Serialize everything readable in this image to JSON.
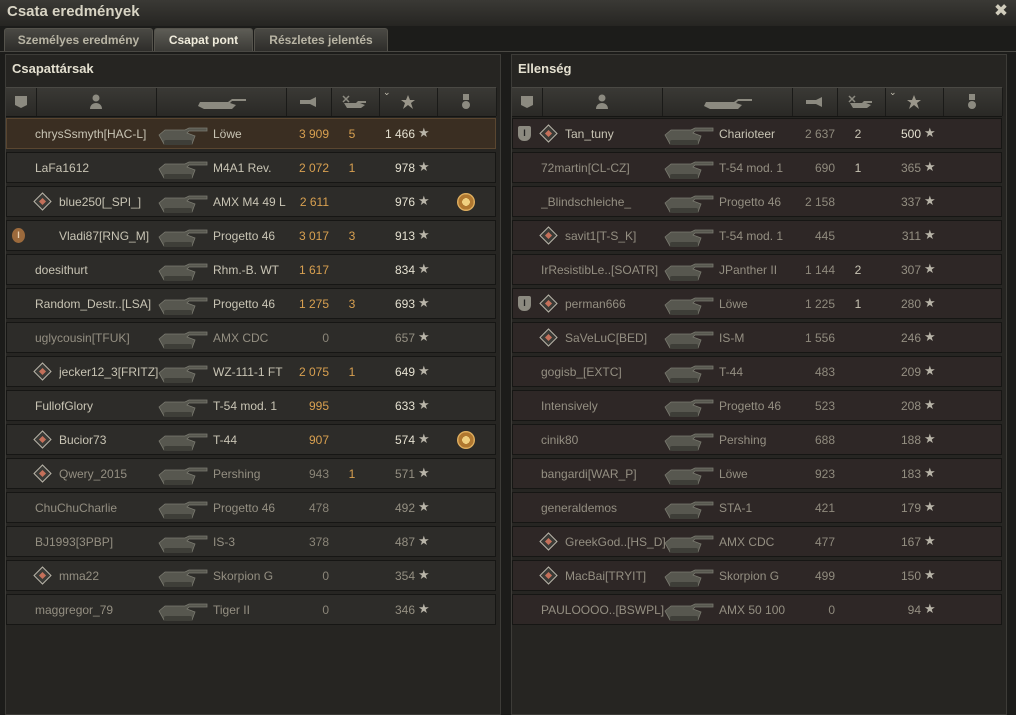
{
  "window": {
    "title": "Csata eredmények",
    "close_glyph": "✖"
  },
  "tabs": [
    {
      "label": "Személyes eredmény",
      "active": false
    },
    {
      "label": "Csapat pont",
      "active": true
    },
    {
      "label": "Részletes jelentés",
      "active": false
    }
  ],
  "columns": {
    "icons": [
      "squad-icon",
      "player-icon",
      "tank-icon",
      "damage-icon",
      "frags-icon",
      "points-star-icon",
      "medal-icon"
    ],
    "sorted_by": "points"
  },
  "colors": {
    "accent_damage": "#d8a050",
    "points": "#e4e0d0",
    "highlight_row": "#3a2e22"
  },
  "teams": [
    {
      "title": "Csapattársak",
      "side": "friendly",
      "rows": [
        {
          "name": "chrysSsmyth[HAC-L]",
          "vehicle": "Löwe",
          "damage": "3 909",
          "frags": "5",
          "points": "1 466",
          "me": true,
          "clan": false,
          "mark": "",
          "medal": false,
          "dead": false
        },
        {
          "name": "LaFa1612",
          "vehicle": "M4A1 Rev.",
          "damage": "2 072",
          "frags": "1",
          "points": "978",
          "clan": false,
          "mark": "",
          "medal": false,
          "dead": false
        },
        {
          "name": "blue250[_SPI_]",
          "vehicle": "AMX M4 49 L",
          "damage": "2 611",
          "frags": "",
          "points": "976",
          "clan": true,
          "mark": "",
          "medal": true,
          "dead": false
        },
        {
          "name": "Vladi87[RNG_M]",
          "vehicle": "Progetto 46",
          "damage": "3 017",
          "frags": "3",
          "points": "913",
          "clan": false,
          "mark": "copper",
          "medal": false,
          "dead": false
        },
        {
          "name": "doesithurt",
          "vehicle": "Rhm.-B. WT",
          "damage": "1 617",
          "frags": "",
          "points": "834",
          "clan": false,
          "mark": "",
          "medal": false,
          "dead": false
        },
        {
          "name": "Random_Destr..[LSA]",
          "vehicle": "Progetto 46",
          "damage": "1 275",
          "frags": "3",
          "points": "693",
          "clan": false,
          "mark": "",
          "medal": false,
          "dead": false
        },
        {
          "name": "uglycousin[TFUK]",
          "vehicle": "AMX CDC",
          "damage": "0",
          "frags": "",
          "points": "657",
          "clan": false,
          "mark": "",
          "medal": false,
          "dead": true
        },
        {
          "name": "jecker12_3[FRITZ]",
          "vehicle": "WZ-111-1 FT",
          "damage": "2 075",
          "frags": "1",
          "points": "649",
          "clan": true,
          "mark": "",
          "medal": false,
          "dead": false
        },
        {
          "name": "FullofGlory",
          "vehicle": "T-54 mod. 1",
          "damage": "995",
          "frags": "",
          "points": "633",
          "clan": false,
          "mark": "",
          "medal": false,
          "dead": false
        },
        {
          "name": "Bucior73",
          "vehicle": "T-44",
          "damage": "907",
          "frags": "",
          "points": "574",
          "clan": true,
          "mark": "",
          "medal": true,
          "dead": false
        },
        {
          "name": "Qwery_2015",
          "vehicle": "Pershing",
          "damage": "943",
          "frags": "1",
          "points": "571",
          "clan": true,
          "mark": "",
          "medal": false,
          "dead": true
        },
        {
          "name": "ChuChuCharlie",
          "vehicle": "Progetto 46",
          "damage": "478",
          "frags": "",
          "points": "492",
          "clan": false,
          "mark": "",
          "medal": false,
          "dead": true
        },
        {
          "name": "BJ1993[3PBP]",
          "vehicle": "IS-3",
          "damage": "378",
          "frags": "",
          "points": "487",
          "clan": false,
          "mark": "",
          "medal": false,
          "dead": true
        },
        {
          "name": "mma22",
          "vehicle": "Skorpion G",
          "damage": "0",
          "frags": "",
          "points": "354",
          "clan": true,
          "mark": "",
          "medal": false,
          "dead": true
        },
        {
          "name": "maggregor_79",
          "vehicle": "Tiger II",
          "damage": "0",
          "frags": "",
          "points": "346",
          "clan": false,
          "mark": "",
          "medal": false,
          "dead": true
        }
      ]
    },
    {
      "title": "Ellenség",
      "side": "enemy",
      "rows": [
        {
          "name": "Tan_tuny",
          "vehicle": "Charioteer",
          "damage": "2 637",
          "frags": "2",
          "points": "500",
          "clan": true,
          "mark": "grey",
          "medal": false,
          "dead": false
        },
        {
          "name": "72martin[CL-CZ]",
          "vehicle": "T-54 mod. 1",
          "damage": "690",
          "frags": "1",
          "points": "365",
          "clan": false,
          "mark": "",
          "medal": false,
          "dead": true
        },
        {
          "name": "_Blindschleiche_",
          "vehicle": "Progetto 46",
          "damage": "2 158",
          "frags": "",
          "points": "337",
          "clan": false,
          "mark": "",
          "medal": false,
          "dead": true
        },
        {
          "name": "savit1[T-S_K]",
          "vehicle": "T-54 mod. 1",
          "damage": "445",
          "frags": "",
          "points": "311",
          "clan": true,
          "mark": "",
          "medal": false,
          "dead": true
        },
        {
          "name": "IrResistibLe..[SOATR]",
          "vehicle": "JPanther II",
          "damage": "1 144",
          "frags": "2",
          "points": "307",
          "clan": false,
          "mark": "",
          "medal": false,
          "dead": true
        },
        {
          "name": "perman666",
          "vehicle": "Löwe",
          "damage": "1 225",
          "frags": "1",
          "points": "280",
          "clan": true,
          "mark": "grey",
          "medal": false,
          "dead": true
        },
        {
          "name": "SaVeLuC[BED]",
          "vehicle": "IS-M",
          "damage": "1 556",
          "frags": "",
          "points": "246",
          "clan": true,
          "mark": "",
          "medal": false,
          "dead": true
        },
        {
          "name": "gogisb_[EXTC]",
          "vehicle": "T-44",
          "damage": "483",
          "frags": "",
          "points": "209",
          "clan": false,
          "mark": "",
          "medal": false,
          "dead": true
        },
        {
          "name": "Intensively",
          "vehicle": "Progetto 46",
          "damage": "523",
          "frags": "",
          "points": "208",
          "clan": false,
          "mark": "",
          "medal": false,
          "dead": true
        },
        {
          "name": "cinik80",
          "vehicle": "Pershing",
          "damage": "688",
          "frags": "",
          "points": "188",
          "clan": false,
          "mark": "",
          "medal": false,
          "dead": true
        },
        {
          "name": "bangardi[WAR_P]",
          "vehicle": "Löwe",
          "damage": "923",
          "frags": "",
          "points": "183",
          "clan": false,
          "mark": "",
          "medal": false,
          "dead": true
        },
        {
          "name": "generaldemos",
          "vehicle": "STA-1",
          "damage": "421",
          "frags": "",
          "points": "179",
          "clan": false,
          "mark": "",
          "medal": false,
          "dead": true
        },
        {
          "name": "GreekGod..[HS_D]",
          "vehicle": "AMX CDC",
          "damage": "477",
          "frags": "",
          "points": "167",
          "clan": true,
          "mark": "",
          "medal": false,
          "dead": true
        },
        {
          "name": "MacBai[TRYIT]",
          "vehicle": "Skorpion G",
          "damage": "499",
          "frags": "",
          "points": "150",
          "clan": true,
          "mark": "",
          "medal": false,
          "dead": true
        },
        {
          "name": "PAULOOOO..[BSWPL]",
          "vehicle": "AMX 50 100",
          "damage": "0",
          "frags": "",
          "points": "94",
          "clan": false,
          "mark": "",
          "medal": false,
          "dead": true
        }
      ]
    }
  ]
}
